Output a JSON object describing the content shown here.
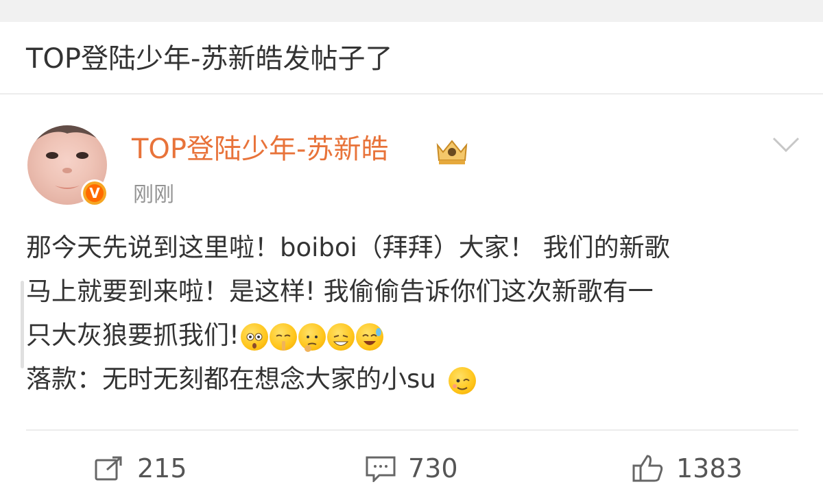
{
  "header": {
    "title": "TOP登陆少年-苏新皓发帖子了"
  },
  "post": {
    "author": "TOP登陆少年-苏新皓",
    "time": "刚刚",
    "lines": [
      "那今天先说到这里啦！boiboi（拜拜）大家！ 我们的新歌",
      "马上就要到来啦！是这样! 我偷偷告诉你们这次新歌有一",
      "只大灰狼要抓我们!",
      "落款：无时无刻都在想念大家的小su"
    ],
    "line3_emojis": [
      "flushed-emoji",
      "shush-emoji",
      "thinking-emoji",
      "grin-emoji",
      "laugh-tears-emoji"
    ],
    "line4_emoji": "wink-emoji"
  },
  "actions": {
    "repost": {
      "icon": "share-icon",
      "count": "215"
    },
    "comment": {
      "icon": "comment-icon",
      "count": "730"
    },
    "like": {
      "icon": "thumbs-up-icon",
      "count": "1383"
    }
  },
  "colors": {
    "username": "#e8733a",
    "verified": "#ff6a00",
    "text": "#333333",
    "muted": "#939393"
  }
}
